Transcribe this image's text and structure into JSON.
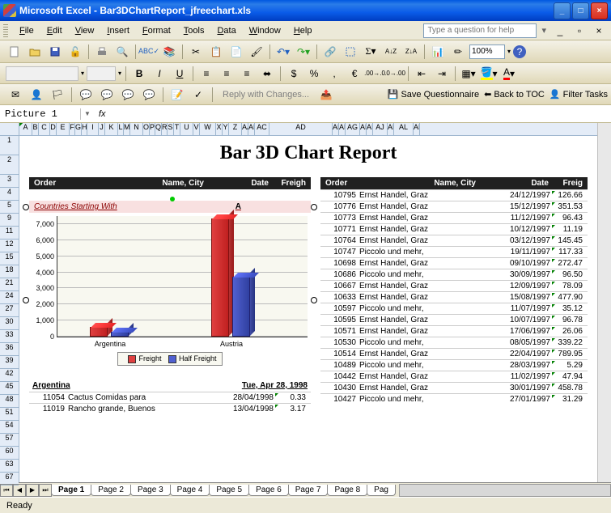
{
  "titlebar": {
    "title": "Microsoft Excel - Bar3DChartReport_jfreechart.xls"
  },
  "menubar": {
    "items": [
      "File",
      "Edit",
      "View",
      "Insert",
      "Format",
      "Tools",
      "Data",
      "Window",
      "Help"
    ],
    "help_placeholder": "Type a question for help"
  },
  "toolbar": {
    "zoom": "100%"
  },
  "reviewbar": {
    "reply": "Reply with Changes...",
    "save": "Save Questionnaire",
    "back": "Back to TOC",
    "filter": "Filter Tasks"
  },
  "namebox": {
    "value": "Picture 1",
    "fx": "fx"
  },
  "col_headers": [
    "A",
    "B",
    "C",
    "D",
    "E",
    "F",
    "G",
    "H",
    "I",
    "J",
    "K",
    "L",
    "M",
    "N",
    "O",
    "P",
    "Q",
    "R",
    "S",
    "T",
    "U",
    "V",
    "W",
    "X",
    "Y",
    "Z",
    "AA",
    "AB",
    "AC",
    "AD",
    "AE",
    "AF",
    "AG",
    "AH",
    "AI",
    "AJ",
    "AK",
    "AL",
    "AM"
  ],
  "row_headers": [
    "1",
    "2",
    "3",
    "4",
    "5",
    "9",
    "11",
    "12",
    "15",
    "18",
    "21",
    "24",
    "27",
    "30",
    "33",
    "36",
    "39",
    "42",
    "45",
    "48",
    "51",
    "54",
    "57",
    "60",
    "63",
    "67"
  ],
  "report": {
    "title": "Bar 3D Chart Report",
    "left_header": {
      "order": "Order",
      "name": "Name, City",
      "date": "Date",
      "freight": "Freigh"
    },
    "right_header": {
      "order": "Order",
      "name": "Name, City",
      "date": "Date",
      "freight": "Freig"
    },
    "countries_label": "Countries Starting With",
    "country_letter": "A",
    "argentina_label": "Argentina",
    "argentina_date": "Tue, Apr 28, 1998",
    "left_rows": [
      {
        "order": "11054",
        "name": "Cactus Comidas para",
        "date": "28/04/1998",
        "freight": "0.33"
      },
      {
        "order": "11019",
        "name": "Rancho grande, Buenos",
        "date": "13/04/1998",
        "freight": "3.17"
      }
    ],
    "right_rows": [
      {
        "order": "10795",
        "name": "Ernst Handel, Graz",
        "date": "24/12/1997",
        "freight": "126.66"
      },
      {
        "order": "10776",
        "name": "Ernst Handel, Graz",
        "date": "15/12/1997",
        "freight": "351.53"
      },
      {
        "order": "10773",
        "name": "Ernst Handel, Graz",
        "date": "11/12/1997",
        "freight": "96.43"
      },
      {
        "order": "10771",
        "name": "Ernst Handel, Graz",
        "date": "10/12/1997",
        "freight": "11.19"
      },
      {
        "order": "10764",
        "name": "Ernst Handel, Graz",
        "date": "03/12/1997",
        "freight": "145.45"
      },
      {
        "order": "10747",
        "name": "Piccolo und mehr,",
        "date": "19/11/1997",
        "freight": "117.33"
      },
      {
        "order": "10698",
        "name": "Ernst Handel, Graz",
        "date": "09/10/1997",
        "freight": "272.47"
      },
      {
        "order": "10686",
        "name": "Piccolo und mehr,",
        "date": "30/09/1997",
        "freight": "96.50"
      },
      {
        "order": "10667",
        "name": "Ernst Handel, Graz",
        "date": "12/09/1997",
        "freight": "78.09"
      },
      {
        "order": "10633",
        "name": "Ernst Handel, Graz",
        "date": "15/08/1997",
        "freight": "477.90"
      },
      {
        "order": "10597",
        "name": "Piccolo und mehr,",
        "date": "11/07/1997",
        "freight": "35.12"
      },
      {
        "order": "10595",
        "name": "Ernst Handel, Graz",
        "date": "10/07/1997",
        "freight": "96.78"
      },
      {
        "order": "10571",
        "name": "Ernst Handel, Graz",
        "date": "17/06/1997",
        "freight": "26.06"
      },
      {
        "order": "10530",
        "name": "Piccolo und mehr,",
        "date": "08/05/1997",
        "freight": "339.22"
      },
      {
        "order": "10514",
        "name": "Ernst Handel, Graz",
        "date": "22/04/1997",
        "freight": "789.95"
      },
      {
        "order": "10489",
        "name": "Piccolo und mehr,",
        "date": "28/03/1997",
        "freight": "5.29"
      },
      {
        "order": "10442",
        "name": "Ernst Handel, Graz",
        "date": "11/02/1997",
        "freight": "47.94"
      },
      {
        "order": "10430",
        "name": "Ernst Handel, Graz",
        "date": "30/01/1997",
        "freight": "458.78"
      },
      {
        "order": "10427",
        "name": "Piccolo und mehr,",
        "date": "27/01/1997",
        "freight": "31.29"
      }
    ]
  },
  "chart_data": {
    "type": "bar",
    "categories": [
      "Argentina",
      "Austria"
    ],
    "series": [
      {
        "name": "Freight",
        "values": [
          600,
          7300
        ],
        "color": "#e04040"
      },
      {
        "name": "Half Freight",
        "values": [
          300,
          3700
        ],
        "color": "#5060d0"
      }
    ],
    "yticks": [
      0,
      1000,
      2000,
      3000,
      4000,
      5000,
      6000,
      7000
    ],
    "ytick_labels": [
      "0",
      "1,000",
      "2,000",
      "3,000",
      "4,000",
      "5,000",
      "6,000",
      "7,000"
    ],
    "ylim": [
      0,
      7500
    ],
    "legend": [
      "Freight",
      "Half Freight"
    ]
  },
  "tabs": [
    "Page 1",
    "Page 2",
    "Page 3",
    "Page 4",
    "Page 5",
    "Page 6",
    "Page 7",
    "Page 8",
    "Pag"
  ],
  "status": "Ready"
}
